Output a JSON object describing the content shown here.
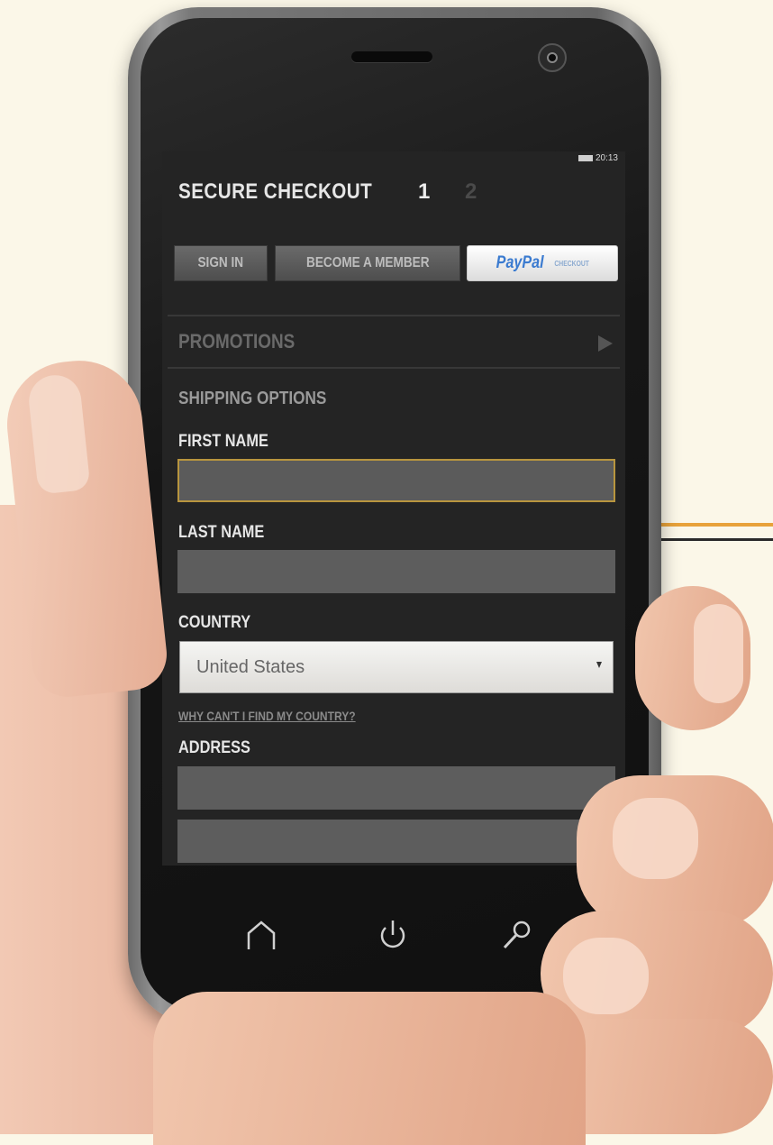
{
  "statusbar": {
    "time": "20:13"
  },
  "checkout": {
    "title": "SECURE CHECKOUT",
    "step_current": "1",
    "step_next": "2"
  },
  "buttons": {
    "sign_in": "SIGN IN",
    "become_member": "BECOME A MEMBER",
    "paypal_brand": "PayPal",
    "paypal_sub": "CHECKOUT"
  },
  "promotions": {
    "label": "PROMOTIONS"
  },
  "shipping": {
    "section_title": "SHIPPING OPTIONS",
    "first_name_label": "FIRST NAME",
    "first_name_value": "",
    "last_name_label": "LAST NAME",
    "last_name_value": "",
    "country_label": "COUNTRY",
    "country_selected": "United States",
    "country_help_link": "WHY CAN'T I FIND MY COUNTRY?",
    "address_label": "ADDRESS",
    "address_line1_value": "",
    "address_line2_value": ""
  },
  "navkeys": [
    "home-icon",
    "power-icon",
    "search-icon"
  ],
  "colors": {
    "background": "#fbf7e8",
    "screen": "#242424",
    "focus_border": "#b8953e",
    "accent_line": "#e8a23a",
    "paypal_blue": "#3b7bd0"
  }
}
